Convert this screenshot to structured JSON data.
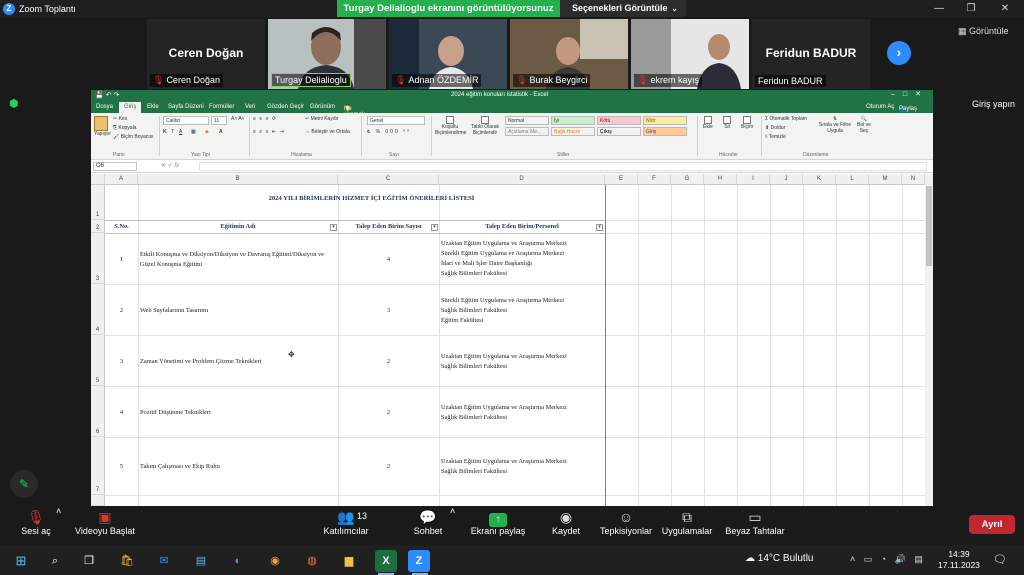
{
  "zoom": {
    "window_title": "Zoom Toplantı",
    "logo_letter": "Z",
    "share_banner": "Turgay Delialioglu ekranını görüntülüyorsunuz",
    "view_options": "Seçenekleri Görüntüle",
    "gallery_label": "Görüntüle",
    "signin_label": "Giriş yapın",
    "participants": [
      {
        "name": "Ceren Doğan",
        "big_name": "Ceren Doğan",
        "muted": true,
        "video": false
      },
      {
        "name": "Turgay Delialioglu",
        "muted": false,
        "video": true
      },
      {
        "name": "Adnan ÖZDEMİR",
        "muted": true,
        "video": true
      },
      {
        "name": "Burak Beygirci",
        "muted": true,
        "video": true
      },
      {
        "name": "ekrem kayış",
        "muted": true,
        "video": true
      },
      {
        "name": "Feridun BADUR",
        "big_name": "Feridun BADUR",
        "muted": false,
        "video": false
      }
    ],
    "toolbar": {
      "mute": "Sesi aç",
      "video": "Videoyu Başlat",
      "participants": "Katılımcılar",
      "participants_count": "13",
      "chat": "Sohbet",
      "share": "Ekranı paylaş",
      "record": "Kaydet",
      "reactions": "Tepkisiyonlar",
      "apps": "Uygulamalar",
      "whiteboards": "Beyaz Tahtalar",
      "end": "Ayrıl"
    }
  },
  "excel": {
    "doc_title": "2024 eğitim konuları istatistik - Excel",
    "signin": "Oturum Aç",
    "share": "Paylaş",
    "tabs": [
      "Dosya",
      "Giriş",
      "Ekle",
      "Sayfa Düzeni",
      "Formüller",
      "Veri",
      "Gözden Geçir",
      "Görünüm"
    ],
    "tell_me": "Ne yapmak istediğinizi söyleyin...",
    "ribbon": {
      "paste": "Yapıştır",
      "cut": "Kes",
      "copy": "Kopyala",
      "format_painter": "Biçim Boyacısı",
      "clipboard": "Pano",
      "font_name": "Calibri",
      "font_size": "11",
      "font_group": "Yazı Tipi",
      "wrap": "Metni Kaydır",
      "merge": "Birleştir ve Ortala",
      "alignment": "Hizalama",
      "number_format": "Genel",
      "number": "Sayı",
      "cond_format": "Koşullu Biçimlendirme",
      "format_table": "Tablo Olarak Biçimlendir",
      "styles": [
        {
          "label": "Normal",
          "bg": "#ffffff",
          "fg": "#000000"
        },
        {
          "label": "İyi",
          "bg": "#c6efce",
          "fg": "#006100"
        },
        {
          "label": "Kötü",
          "bg": "#ffc7ce",
          "fg": "#9c0006"
        },
        {
          "label": "Nötr",
          "bg": "#ffeb9c",
          "fg": "#9c5700"
        },
        {
          "label": "Açıklama Me...",
          "bg": "#ffffff",
          "fg": "#7f7f7f"
        },
        {
          "label": "Bağlı Hücre",
          "bg": "#ffffff",
          "fg": "#fa7d00"
        },
        {
          "label": "Çıkış",
          "bg": "#f2f2f2",
          "fg": "#3f3f3f"
        },
        {
          "label": "Giriş",
          "bg": "#ffcc99",
          "fg": "#3f3f76"
        }
      ],
      "styles_group": "Stiller",
      "insert": "Ekle",
      "delete": "Sil",
      "format": "Biçim",
      "cells": "Hücreler",
      "autosum": "Otomatik Toplam",
      "fill": "Doldur",
      "clear": "Temizle",
      "sort_filter": "Sırala ve Filtre Uygula",
      "find": "Bul ve Seç",
      "editing": "Düzenleme"
    },
    "name_box": "O6",
    "columns": [
      "A",
      "B",
      "C",
      "D",
      "E",
      "F",
      "G",
      "H",
      "I",
      "J",
      "K",
      "L",
      "M",
      "N"
    ],
    "sheet": {
      "title": "2024 YILI BİRİMLERİN HİZMET İÇİ EĞİTİM ÖNERİLERİ LİSTESİ",
      "headers": [
        "S.No.",
        "Eğitimin Adı",
        "Talep Eden Birim Sayısı",
        "Talep Eden Birim/Personel"
      ],
      "rows": [
        {
          "rownum": "3",
          "no": "1",
          "name": "Etkili Konuşma ve Diksiyon/Diksiyon ve Davranış Eğitimi/Diksiyon ve Güzel Konuşma Eğitimi",
          "count": "4",
          "units": [
            "Uzaktan Eğitim Uygulama ve Araştırma Merkezi",
            "Sürekli Eğitim Uygulama ve Araştırma Merkezi",
            "İdari ve Mali İşler Daire Başkanlığı",
            "Sağlık Bilimleri Fakültesi"
          ]
        },
        {
          "rownum": "4",
          "no": "2",
          "name": "Web Sayfalarının Tasarımı",
          "count": "3",
          "units": [
            "Sürekli Eğitim Uygulama ve Araştırma Merkezi",
            "Sağlık Bilimleri Fakültesi",
            "Eğitim Fakültesi"
          ]
        },
        {
          "rownum": "5",
          "no": "3",
          "name": "Zaman Yönetimi ve Problem Çözme Teknikleri",
          "count": "2",
          "units": [
            "Uzaktan Eğitim Uygulama ve Araştırma Merkezi",
            "Sağlık Bilimleri Fakültesi"
          ]
        },
        {
          "rownum": "6",
          "no": "4",
          "name": "Pozitif Düşünme Teknikleri",
          "count": "2",
          "units": [
            "Uzaktan Eğitim Uygulama ve Araştırma Merkezi",
            "Sağlık Bilimleri Fakültesi"
          ]
        },
        {
          "rownum": "7",
          "no": "5",
          "name": "Takım Çalışması ve Ekip Ruhu",
          "count": "2",
          "units": [
            "Uzaktan Eğitim Uygulama ve Araştırma Merkezi",
            "Sağlık Bilimleri Fakültesi"
          ]
        }
      ],
      "rownum_title": "1",
      "rownum_header": "2"
    }
  },
  "taskbar": {
    "weather": "14°C  Bulutlu",
    "time": "14:39",
    "date": "17.11.2023"
  }
}
